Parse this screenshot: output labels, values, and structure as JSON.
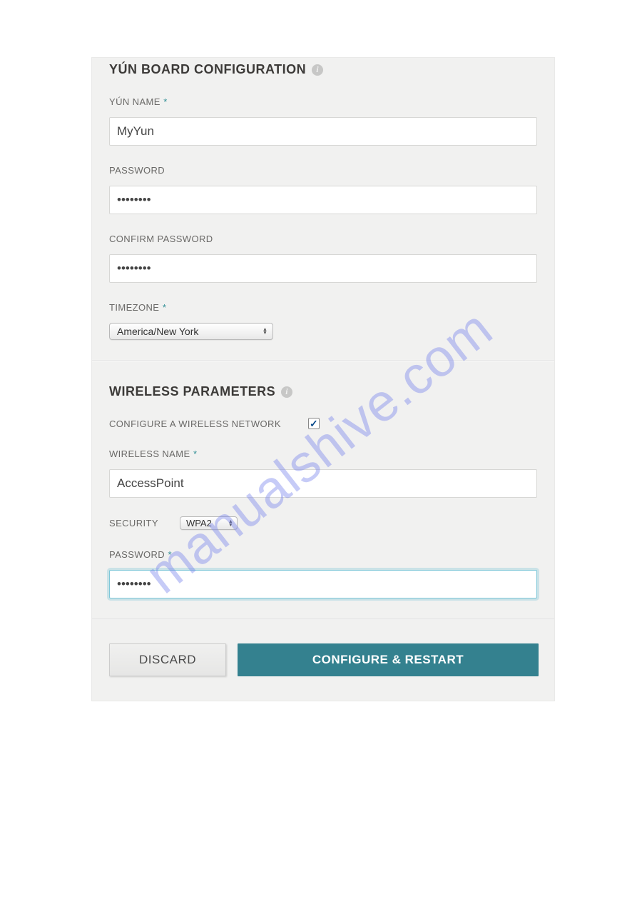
{
  "watermark": "manualshive.com",
  "section1": {
    "title": "YÚN BOARD CONFIGURATION",
    "name_label": "YÚN NAME",
    "name_value": "MyYun",
    "password_label": "PASSWORD",
    "password_value": "••••••••",
    "confirm_label": "CONFIRM PASSWORD",
    "confirm_value": "••••••••",
    "timezone_label": "TIMEZONE",
    "timezone_value": "America/New York"
  },
  "section2": {
    "title": "WIRELESS PARAMETERS",
    "configure_label": "CONFIGURE A WIRELESS NETWORK",
    "configure_checked": true,
    "wname_label": "WIRELESS NAME",
    "wname_value": "AccessPoint",
    "security_label": "SECURITY",
    "security_value": "WPA2",
    "wpass_label": "PASSWORD",
    "wpass_value": "••••••••"
  },
  "buttons": {
    "discard": "DISCARD",
    "submit": "CONFIGURE & RESTART"
  },
  "required_marker": "*",
  "check_glyph": "✓"
}
